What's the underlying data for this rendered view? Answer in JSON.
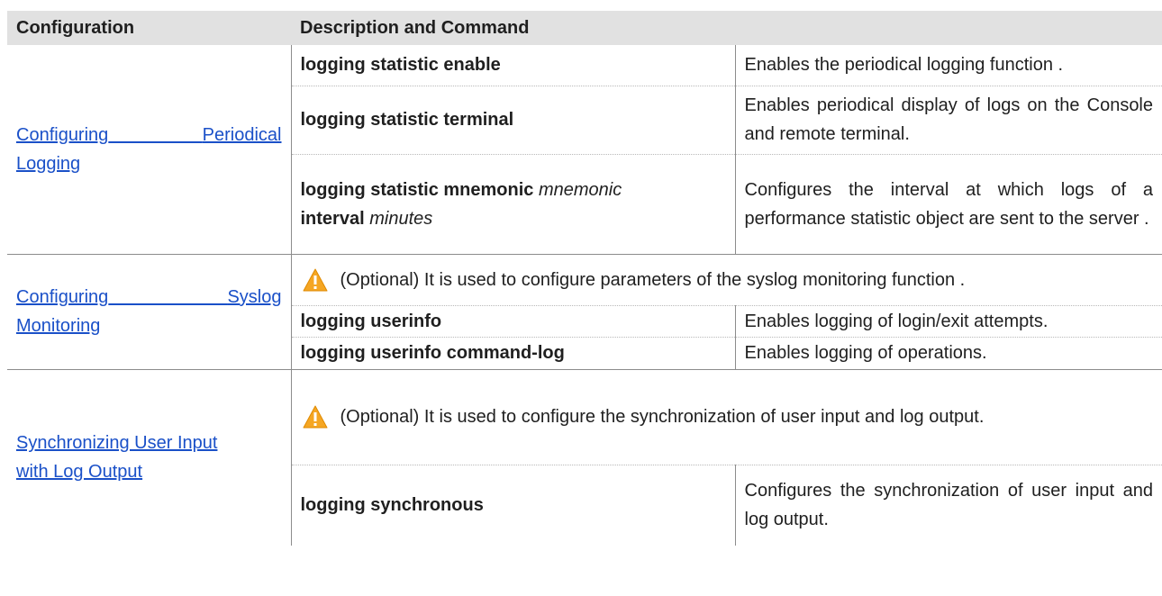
{
  "header": {
    "col1": "Configuration",
    "col2": "Description and Command"
  },
  "sections": [
    {
      "link": [
        "Configuring",
        "Periodical",
        "Logging"
      ],
      "rows": [
        {
          "cmd": "logging statistic enable",
          "desc": "Enables the periodical logging function ."
        },
        {
          "cmd": "logging statistic terminal",
          "desc": "Enables periodical display of logs on the Console and remote terminal."
        },
        {
          "cmd_parts": [
            "logging statistic mnemonic",
            "mnemonic",
            "interval",
            "minutes"
          ],
          "desc": "Configures the interval at which logs of a performance statistic object are sent to the server ."
        }
      ]
    },
    {
      "link": [
        "Configuring",
        "Syslog",
        "Monitoring"
      ],
      "note": "(Optional) It is used to configure parameters of the syslog monitoring function .",
      "rows": [
        {
          "cmd": "logging userinfo",
          "desc": "Enables logging of login/exit attempts."
        },
        {
          "cmd": "logging userinfo command-log",
          "desc": "Enables logging of operations."
        }
      ]
    },
    {
      "link": [
        "Synchronizing User Input",
        "with Log Output"
      ],
      "note": "(Optional) It is used to configure the synchronization of user input and log output.",
      "rows": [
        {
          "cmd": "logging synchronous",
          "desc": "Configures the synchronization of user input and log output."
        }
      ]
    }
  ],
  "icons": {
    "warning": "warning-triangle-icon"
  },
  "colors": {
    "link": "#1a50c8",
    "header_bg": "#e1e1e1",
    "warning": "#f5a623"
  }
}
